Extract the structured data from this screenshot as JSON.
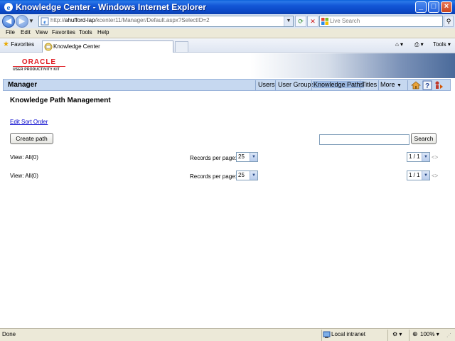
{
  "window": {
    "title": "Knowledge Center - Windows Internet Explorer"
  },
  "address": {
    "url_prefix": "http://",
    "url_host": "ahufford-lap",
    "url_path": "/kcenter11/Manager/Default.aspx?SelectID=2",
    "search_placeholder": "Live Search"
  },
  "menu": {
    "items": [
      "File",
      "Edit",
      "View",
      "Favorites",
      "Tools",
      "Help"
    ]
  },
  "favorites": {
    "label": "Favorites",
    "tab_label": "Knowledge Center",
    "tools_label": "Tools"
  },
  "branding": {
    "logo_word": "ORACLE",
    "logo_sub": "USER PRODUCTIVITY KIT",
    "brand_color": "#e01b22"
  },
  "nav": {
    "section": "Manager",
    "links": [
      "Users",
      "User Groups",
      "Knowledge Paths",
      "Titles",
      "More"
    ],
    "active": "Knowledge Paths"
  },
  "page": {
    "title": "Knowledge Path Management",
    "sort_link": "Edit Sort Order",
    "create_button": "Create path",
    "search_button": "Search",
    "search_value": ""
  },
  "lists": [
    {
      "view_label": "View: All(",
      "view_count": "0",
      "view_close": ")",
      "records_label": "Records per page:",
      "records_value": "25",
      "page_value": "1 / 1",
      "prev": "<",
      "next": ">"
    },
    {
      "view_label": "View: All(",
      "view_count": "0",
      "view_close": ")",
      "records_label": "Records per page:",
      "records_value": "25",
      "page_value": "1 / 1",
      "prev": "<",
      "next": ">"
    }
  ],
  "status": {
    "text": "Done",
    "zone": "Local intranet",
    "zoom": "100%"
  }
}
